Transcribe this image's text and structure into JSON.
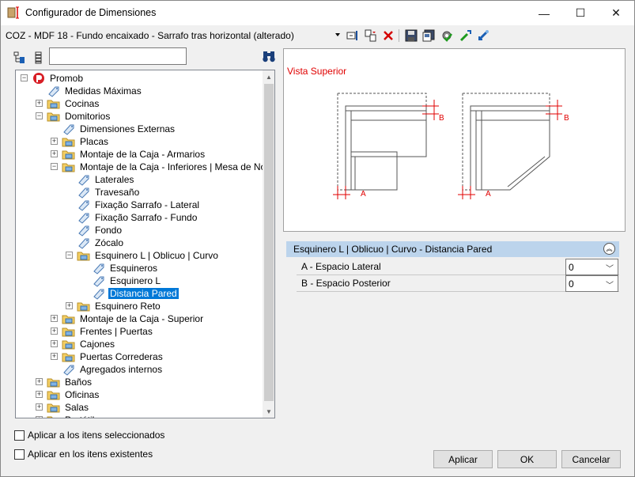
{
  "window": {
    "title": "Configurador de Dimensiones",
    "minimize_glyph": "—",
    "maximize_glyph": "☐",
    "close_glyph": "✕"
  },
  "toolbar": {
    "config_name": "COZ - MDF 18 - Fundo encaixado - Sarrafo tras horizontal (alterado)",
    "icons": [
      "rename-icon",
      "duplicate-icon",
      "delete-icon",
      "save-icon",
      "save-as-icon",
      "settings-icon",
      "import-icon",
      "export-icon"
    ]
  },
  "tree": {
    "search_value": "",
    "nodes": [
      {
        "label": "Promob",
        "level": 0,
        "icon": "promob-logo-icon",
        "expander": "−"
      },
      {
        "label": "Medidas Máximas",
        "level": 1,
        "icon": "tag-icon",
        "expander": ""
      },
      {
        "label": "Cocinas",
        "level": 1,
        "icon": "folder-icon",
        "expander": "+"
      },
      {
        "label": "Domitorios",
        "level": 1,
        "icon": "folder-icon",
        "expander": "−"
      },
      {
        "label": "Dimensiones Externas",
        "level": 2,
        "icon": "tag-icon",
        "expander": ""
      },
      {
        "label": "Placas",
        "level": 2,
        "icon": "folder-icon",
        "expander": "+"
      },
      {
        "label": "Montaje de la Caja - Armarios",
        "level": 2,
        "icon": "folder-icon",
        "expander": "+"
      },
      {
        "label": "Montaje de la Caja - Inferiores | Mesa de Noche",
        "level": 2,
        "icon": "folder-icon",
        "expander": "−"
      },
      {
        "label": "Laterales",
        "level": 3,
        "icon": "tag-icon",
        "expander": ""
      },
      {
        "label": "Travesaño",
        "level": 3,
        "icon": "tag-icon",
        "expander": ""
      },
      {
        "label": "Fixação Sarrafo - Lateral",
        "level": 3,
        "icon": "tag-icon",
        "expander": ""
      },
      {
        "label": "Fixação Sarrafo - Fundo",
        "level": 3,
        "icon": "tag-icon",
        "expander": ""
      },
      {
        "label": "Fondo",
        "level": 3,
        "icon": "tag-icon",
        "expander": ""
      },
      {
        "label": "Zócalo",
        "level": 3,
        "icon": "tag-icon",
        "expander": ""
      },
      {
        "label": "Esquinero L | Oblicuo | Curvo",
        "level": 3,
        "icon": "folder-icon",
        "expander": "−"
      },
      {
        "label": "Esquineros",
        "level": 4,
        "icon": "tag-icon",
        "expander": ""
      },
      {
        "label": "Esquinero L",
        "level": 4,
        "icon": "tag-icon",
        "expander": ""
      },
      {
        "label": "Distancia Pared",
        "level": 4,
        "icon": "tag-icon",
        "expander": "",
        "selected": true
      },
      {
        "label": "Esquinero Reto",
        "level": 3,
        "icon": "folder-icon",
        "expander": "+"
      },
      {
        "label": "Montaje de la Caja - Superior",
        "level": 2,
        "icon": "folder-icon",
        "expander": "+"
      },
      {
        "label": "Frentes | Puertas",
        "level": 2,
        "icon": "folder-icon",
        "expander": "+"
      },
      {
        "label": "Cajones",
        "level": 2,
        "icon": "folder-icon",
        "expander": "+"
      },
      {
        "label": "Puertas Correderas",
        "level": 2,
        "icon": "folder-icon",
        "expander": "+"
      },
      {
        "label": "Agregados internos",
        "level": 2,
        "icon": "tag-icon",
        "expander": ""
      },
      {
        "label": "Baños",
        "level": 1,
        "icon": "folder-icon",
        "expander": "+"
      },
      {
        "label": "Oficinas",
        "level": 1,
        "icon": "folder-icon",
        "expander": "+"
      },
      {
        "label": "Salas",
        "level": 1,
        "icon": "folder-icon",
        "expander": "+"
      },
      {
        "label": "Portátiles",
        "level": 1,
        "icon": "folder-icon",
        "expander": "+"
      }
    ]
  },
  "preview": {
    "title": "Vista Superior",
    "labels": {
      "a": "A",
      "b": "B"
    }
  },
  "section": {
    "title": "Esquinero L | Oblicuo | Curvo - Distancia Pared",
    "properties": [
      {
        "label": "A - Espacio Lateral",
        "value": "0"
      },
      {
        "label": "B - Espacio Posterior",
        "value": "0"
      }
    ]
  },
  "options": {
    "apply_selected": "Aplicar a los itens seleccionados",
    "apply_existing": "Aplicar en los itens existentes"
  },
  "buttons": {
    "apply": "Aplicar",
    "ok": "OK",
    "cancel": "Cancelar"
  },
  "colors": {
    "accent_red": "#e00000",
    "selection": "#0078d7",
    "section_header": "#bcd4ec"
  }
}
